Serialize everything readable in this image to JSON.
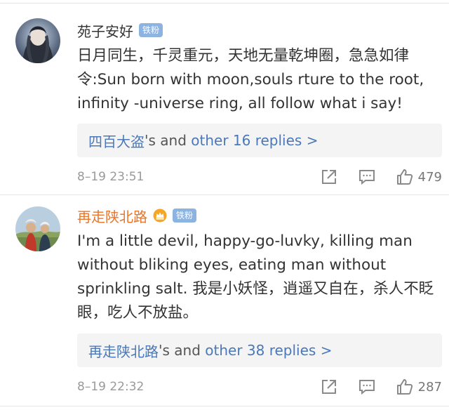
{
  "comments": [
    {
      "username": "苑子安好",
      "username_color": "#333333",
      "badge": "铁粉",
      "text": "日月同生，千灵重元，天地无量乾坤圈，急急如律令:Sun born with moon,souls rture to the root, infinity -universe ring, all follow what i say!",
      "replies": {
        "name": "四百大盗",
        "middle": "'s and ",
        "other": "other 16 replies >"
      },
      "timestamp": "8–19 23:51",
      "likes": "479"
    },
    {
      "username": "再走陕北路",
      "username_color": "#e8762d",
      "badge": "铁粉",
      "text": "I'm a little devil, happy-go-luvky, killing man without bliking eyes, eating man without sprinkling salt. 我是小妖怪，逍遥又自在，杀人不眨眼，吃人不放盐。",
      "replies": {
        "name": "再走陕北路",
        "middle": "'s and ",
        "other": "other 38 replies >"
      },
      "timestamp": "8–19 22:32",
      "likes": "287"
    }
  ],
  "icons": {
    "share": "share-icon",
    "reply": "comment-icon",
    "like": "thumbs-up-icon",
    "crown": "crown-icon"
  },
  "colors": {
    "link": "#4a78b8",
    "badge": "#8db3e0",
    "crown": "#f5a623",
    "orange_username": "#e8762d"
  }
}
